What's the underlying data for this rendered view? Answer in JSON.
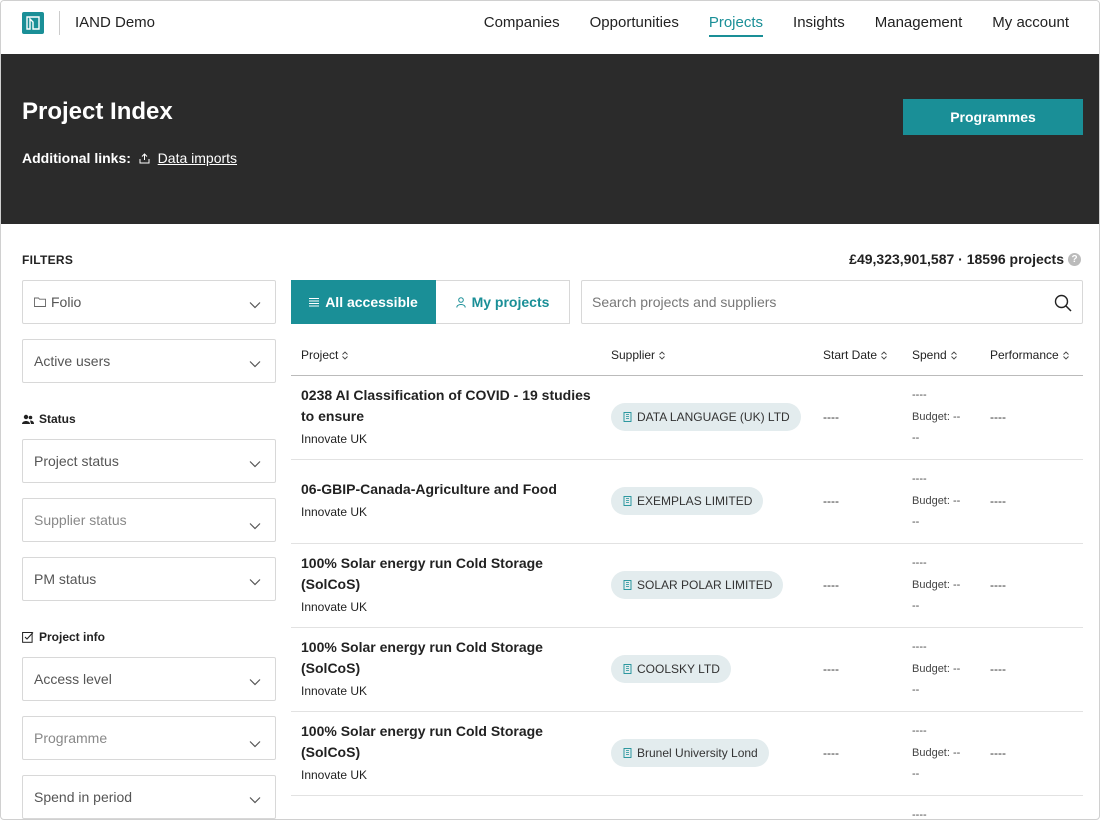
{
  "app": {
    "name": "IAND Demo"
  },
  "nav": {
    "items": [
      "Companies",
      "Opportunities",
      "Projects",
      "Insights",
      "Management",
      "My account"
    ],
    "active": "Projects"
  },
  "header": {
    "title": "Project Index",
    "links_label": "Additional links:",
    "data_imports": "Data imports",
    "programmes_button": "Programmes"
  },
  "filters": {
    "title": "FILTERS",
    "folio": "Folio",
    "active_users": "Active users",
    "status_section": "Status",
    "project_status": "Project status",
    "supplier_status": "Supplier status",
    "pm_status": "PM status",
    "project_info_section": "Project info",
    "access_level": "Access level",
    "programme": "Programme",
    "spend_in_period": "Spend in period"
  },
  "summary": {
    "text": "£49,323,901,587 · 18596 projects",
    "info": "?"
  },
  "tabs": {
    "all": "All accessible",
    "mine": "My projects"
  },
  "search": {
    "placeholder": "Search projects and suppliers",
    "value": ""
  },
  "table": {
    "columns": [
      "Project",
      "Supplier",
      "Start Date",
      "Spend",
      "Performance"
    ],
    "rows": [
      {
        "line1": "0238 AI Classification of COVID - 19 studies",
        "line2": "to ensure",
        "org": "Innovate UK",
        "supplier": "DATA LANGUAGE (UK) LTD",
        "start": "----",
        "spend": "----",
        "budget": "Budget: --",
        "budget2": "--",
        "performance": "----"
      },
      {
        "line1": "06-GBIP-Canada-Agriculture and Food",
        "line2": "",
        "org": "Innovate UK",
        "supplier": "EXEMPLAS LIMITED",
        "start": "----",
        "spend": "----",
        "budget": "Budget: --",
        "budget2": "--",
        "performance": "----"
      },
      {
        "line1": "100% Solar energy run Cold Storage",
        "line2": "(SolCoS)",
        "org": "Innovate UK",
        "supplier": "SOLAR POLAR LIMITED",
        "start": "----",
        "spend": "----",
        "budget": "Budget: --",
        "budget2": "--",
        "performance": "----"
      },
      {
        "line1": "100% Solar energy run Cold Storage",
        "line2": "(SolCoS)",
        "org": "Innovate UK",
        "supplier": "COOLSKY LTD",
        "start": "----",
        "spend": "----",
        "budget": "Budget: --",
        "budget2": "--",
        "performance": "----"
      },
      {
        "line1": "100% Solar energy run Cold Storage",
        "line2": "(SolCoS)",
        "org": "Innovate UK",
        "supplier": "Brunel University Lond",
        "start": "----",
        "spend": "----",
        "budget": "Budget: --",
        "budget2": "--",
        "performance": "----"
      }
    ],
    "partial_row_spend": "----"
  },
  "colors": {
    "accent": "#1a8f97",
    "hero_bg": "#2b2b2b",
    "chip_bg": "#e3ecee"
  }
}
